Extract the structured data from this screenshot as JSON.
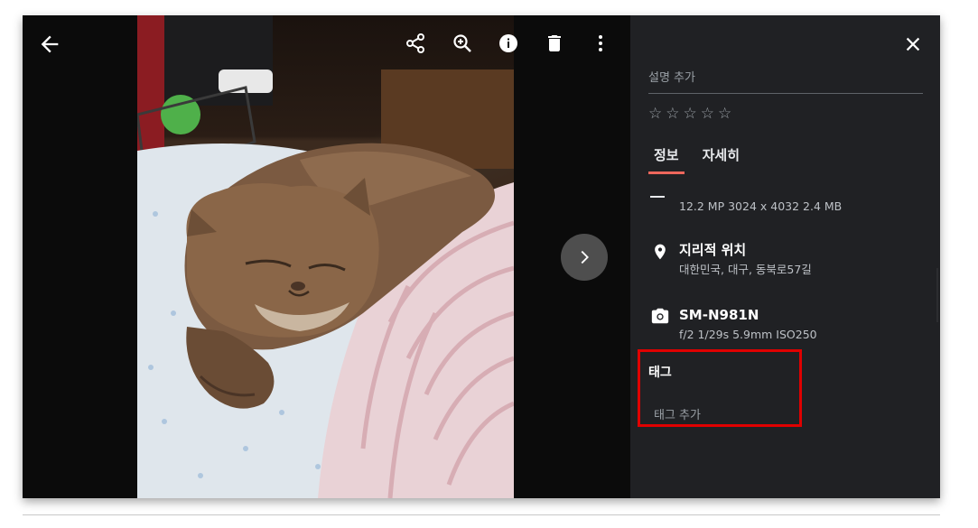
{
  "panel": {
    "description_placeholder": "설명 추가",
    "rating_stars": [
      "☆",
      "☆",
      "☆",
      "☆",
      "☆"
    ],
    "tabs": [
      {
        "label": "정보",
        "active": true
      },
      {
        "label": "자세히",
        "active": false
      }
    ],
    "file_info": "12.2 MP  3024 x 4032  2.4 MB",
    "location": {
      "title": "지리적 위치",
      "address": "대한민국, 대구, 동북로57길",
      "icon": "location-pin-icon"
    },
    "camera": {
      "title": "SM-N981N",
      "settings": "f/2  1/29s  5.9mm  ISO250",
      "icon": "camera-icon"
    },
    "tags": {
      "title": "태그",
      "add_placeholder": "태그 추가",
      "highlight_color": "#e00000"
    },
    "accent_color": "#ee675c"
  },
  "toolbar": {
    "icons": [
      "back-arrow-icon",
      "share-icon",
      "zoom-in-icon",
      "info-icon",
      "delete-icon",
      "more-vert-icon",
      "close-icon",
      "chevron-right-icon"
    ]
  }
}
